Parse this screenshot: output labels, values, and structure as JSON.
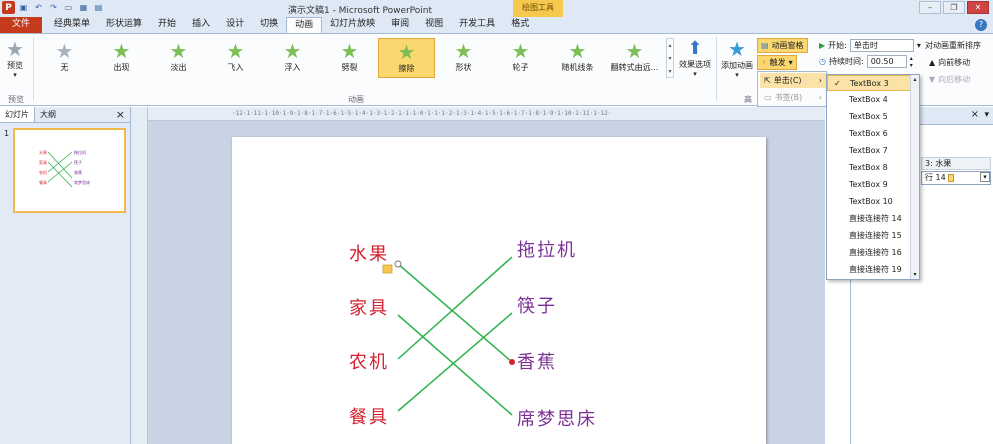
{
  "window": {
    "title": "演示文稿1 - Microsoft PowerPoint",
    "context_tool": "绘图工具",
    "logo": "P",
    "qat_icons": [
      "save-icon",
      "undo-icon",
      "redo-icon",
      "slideshow-icon",
      "table-icon",
      "print-icon"
    ],
    "controls": [
      "minimize-icon",
      "restore-icon",
      "close-icon"
    ]
  },
  "tabs": [
    {
      "label": "文件"
    },
    {
      "label": "经典菜单"
    },
    {
      "label": "形状运算"
    },
    {
      "label": "开始"
    },
    {
      "label": "插入"
    },
    {
      "label": "设计"
    },
    {
      "label": "切换"
    },
    {
      "label": "动画"
    },
    {
      "label": "幻灯片放映"
    },
    {
      "label": "审阅"
    },
    {
      "label": "视图"
    },
    {
      "label": "开发工具"
    },
    {
      "label": "格式"
    }
  ],
  "ribbon": {
    "preview": {
      "label": "预览",
      "group": "预览"
    },
    "animation_group": "动画",
    "gallery": [
      "无",
      "出现",
      "淡出",
      "飞入",
      "浮入",
      "劈裂",
      "擦除",
      "形状",
      "轮子",
      "随机线条",
      "翻转式由远..."
    ],
    "effect_options": "效果选项",
    "add_animation": "添加动画",
    "advanced_group": "高",
    "animation_pane": "动画窗格",
    "trigger": "触发",
    "trigger_arrow": "▾",
    "start_label": "开始:",
    "start_value": "单击时",
    "duration_label": "持续时间:",
    "duration_value": "00.50",
    "reorder_title": "对动画重新排序",
    "move_earlier": "向前移动",
    "move_later": "向后移动"
  },
  "submenu": {
    "click": "单击(C)",
    "bookmark": "书签(B)"
  },
  "dropdown": {
    "items": [
      "TextBox 3",
      "TextBox 4",
      "TextBox 5",
      "TextBox 6",
      "TextBox 7",
      "TextBox 8",
      "TextBox 9",
      "TextBox 10",
      "直接连接符 14",
      "直接连接符 15",
      "直接连接符 16",
      "直接连接符 19"
    ],
    "selected_index": 0,
    "check": "✓"
  },
  "left_pane": {
    "tabs": [
      "幻灯片",
      "大纲"
    ],
    "close": "×",
    "slide_number": "1"
  },
  "ruler": {
    "marks": "·12·1·11·1·10·1·9·1·8·1·7·1·6·1·5·1·4·1·3·1·2·1·1·1·0·1·1·1·2·1·3·1·4·1·5·1·6·1·7·1·8·1·9·1·10·1·11·1·12·"
  },
  "slide": {
    "left_words": [
      "水果",
      "家具",
      "农机",
      "餐具"
    ],
    "right_words": [
      "拖拉机",
      "筷子",
      "香蕉",
      "席梦思床"
    ],
    "line_color": "#2fb34d",
    "left_color": "#d6212f",
    "right_color": "#7b3096"
  },
  "right_pane": {
    "close": "×",
    "col_label": "3: 水果",
    "row_value": "行 14"
  }
}
